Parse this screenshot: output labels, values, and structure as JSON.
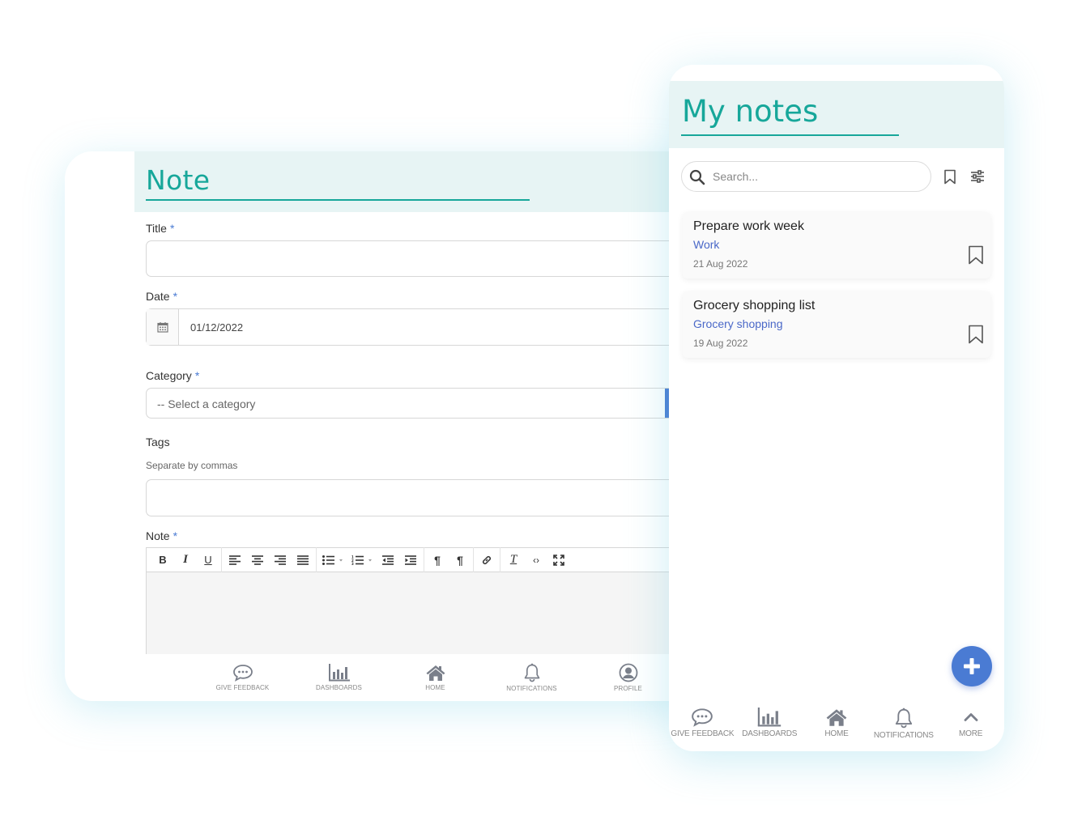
{
  "note_form": {
    "title": "Note",
    "fields": {
      "title_label": "Title",
      "date_label": "Date",
      "date_value": "01/12/2022",
      "category_label": "Category",
      "category_placeholder": "-- Select a category",
      "tags_label": "Tags",
      "tags_hint": "Separate by commas",
      "note_label": "Note",
      "required_marker": "*"
    },
    "toolbar_icons": [
      "bold-icon",
      "italic-icon",
      "underline-icon",
      "align-left-icon",
      "align-center-icon",
      "align-right-icon",
      "align-justify-icon",
      "bullet-list-icon",
      "numbered-list-icon",
      "outdent-icon",
      "indent-icon",
      "ltr-icon",
      "rtl-icon",
      "link-icon",
      "clear-format-icon",
      "code-icon",
      "fullscreen-icon"
    ],
    "bottom_nav": [
      {
        "label": "GIVE FEEDBACK",
        "icon": "chat-icon"
      },
      {
        "label": "DASHBOARDS",
        "icon": "bar-chart-icon"
      },
      {
        "label": "HOME",
        "icon": "home-icon"
      },
      {
        "label": "NOTIFICATIONS",
        "icon": "bell-icon"
      },
      {
        "label": "PROFILE",
        "icon": "user-circle-icon"
      }
    ]
  },
  "my_notes": {
    "title": "My notes",
    "search": {
      "placeholder": "Search..."
    },
    "notes": [
      {
        "title": "Prepare work week",
        "category": "Work",
        "date": "21 Aug 2022"
      },
      {
        "title": "Grocery shopping list",
        "category": "Grocery shopping",
        "date": "19 Aug 2022"
      }
    ],
    "bottom_nav": [
      {
        "label": "GIVE FEEDBACK",
        "icon": "chat-icon"
      },
      {
        "label": "DASHBOARDS",
        "icon": "bar-chart-icon"
      },
      {
        "label": "HOME",
        "icon": "home-icon"
      },
      {
        "label": "NOTIFICATIONS",
        "icon": "bell-icon"
      },
      {
        "label": "MORE",
        "icon": "chevron-up-icon"
      }
    ]
  },
  "colors": {
    "accent_teal": "#17a79a",
    "header_bg": "#e7f4f4",
    "primary_blue": "#4a7bd3",
    "category_link": "#4a68c8"
  }
}
